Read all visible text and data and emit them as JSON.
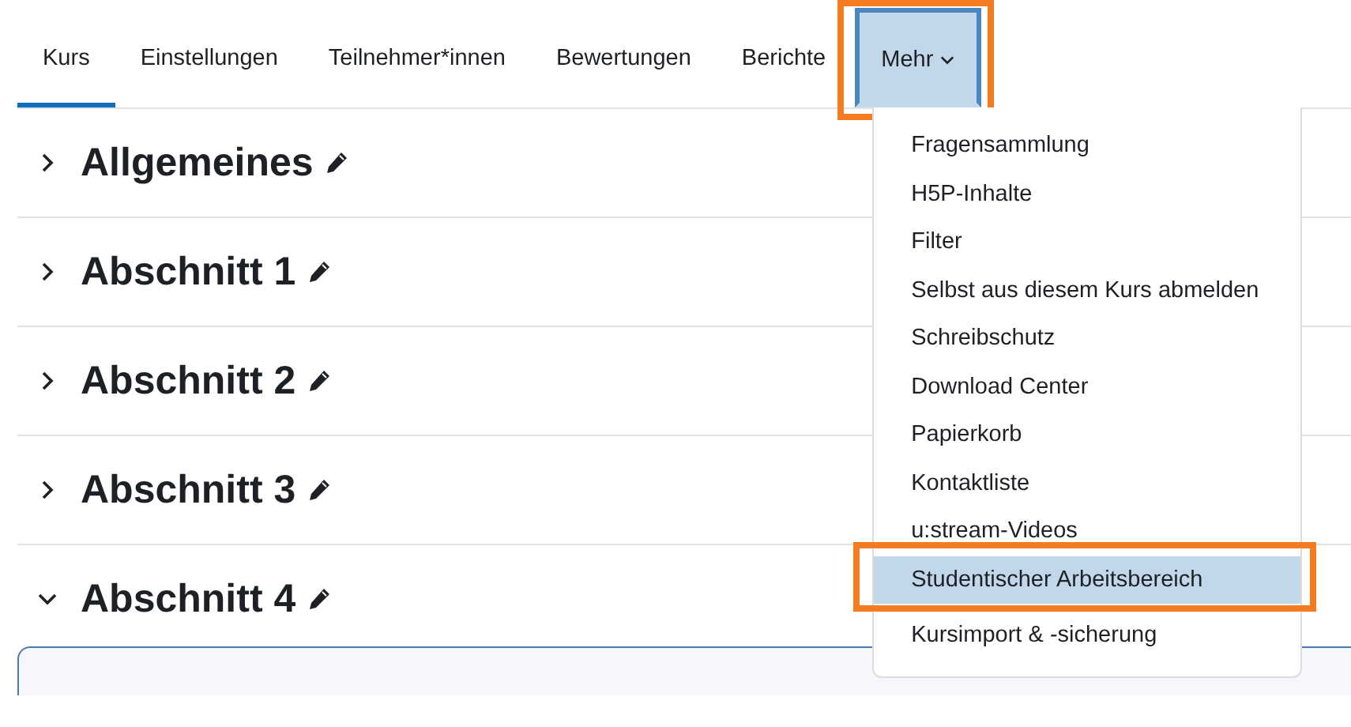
{
  "tabs": [
    {
      "label": "Kurs",
      "selected": true
    },
    {
      "label": "Einstellungen",
      "selected": false
    },
    {
      "label": "Teilnehmer*innen",
      "selected": false
    },
    {
      "label": "Bewertungen",
      "selected": false
    },
    {
      "label": "Berichte",
      "selected": false
    },
    {
      "label": "Mehr",
      "selected": false,
      "expanded": true,
      "annotated": true,
      "kind": "dropdown"
    }
  ],
  "menu": [
    {
      "label": "Fragensammlung",
      "selected": false
    },
    {
      "label": "H5P-Inhalte",
      "selected": false
    },
    {
      "label": "Filter",
      "selected": false
    },
    {
      "label": "Selbst aus diesem Kurs abmelden",
      "selected": false
    },
    {
      "label": "Schreibschutz",
      "selected": false
    },
    {
      "label": "Download Center",
      "selected": false
    },
    {
      "label": "Papierkorb",
      "selected": false
    },
    {
      "label": "Kontaktliste",
      "selected": false
    },
    {
      "label": "u:stream-Videos",
      "selected": false
    },
    {
      "label": "Studentischer Arbeitsbereich",
      "selected": true,
      "annotated": true
    },
    {
      "label": "Kursimport & -sicherung",
      "selected": false
    }
  ],
  "sections": [
    {
      "title": "Allgemeines",
      "expanded": false
    },
    {
      "title": "Abschnitt 1",
      "expanded": false
    },
    {
      "title": "Abschnitt 2",
      "expanded": false
    },
    {
      "title": "Abschnitt 3",
      "expanded": false
    },
    {
      "title": "Abschnitt 4",
      "expanded": true
    }
  ]
}
